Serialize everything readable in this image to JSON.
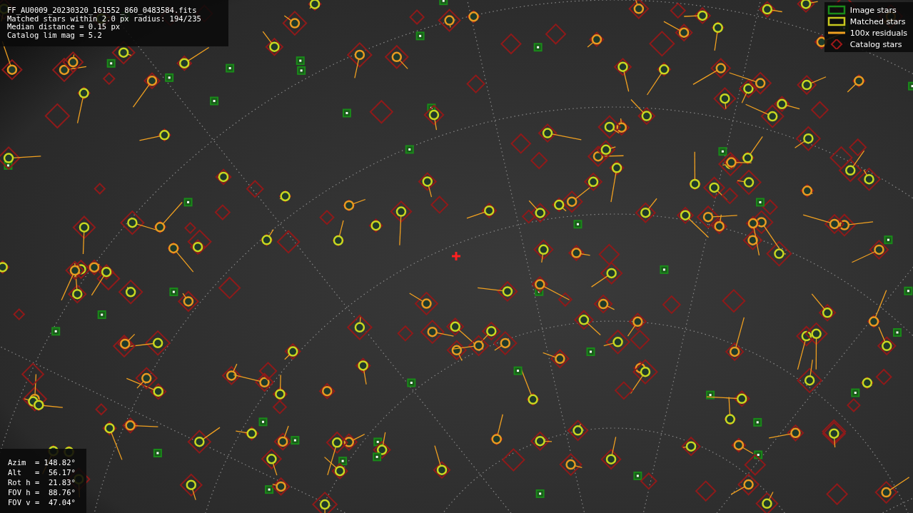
{
  "info_box": {
    "lines": [
      "FF_AU0009_20230320_161552_860_0483584.fits",
      "Matched stars within 2.0 px radius: 194/235",
      "Median distance = 0.15 px",
      "Catalog lim mag = 5.2"
    ]
  },
  "legend": [
    {
      "kind": "box",
      "color": "#1a8a1a",
      "label": "Image stars"
    },
    {
      "kind": "box",
      "color": "#c8c81e",
      "label": "Matched stars"
    },
    {
      "kind": "line",
      "color": "#f0a020",
      "label": "100x residuals"
    },
    {
      "kind": "diamond",
      "color": "#a01818",
      "label": "Catalog stars"
    }
  ],
  "pointing_box": {
    "lines": [
      "Azim  = 148.82°",
      "Alt   =  56.17°",
      "Rot h =  21.83°",
      "FOV h =  88.76°",
      "FOV v =  47.04°"
    ]
  }
}
